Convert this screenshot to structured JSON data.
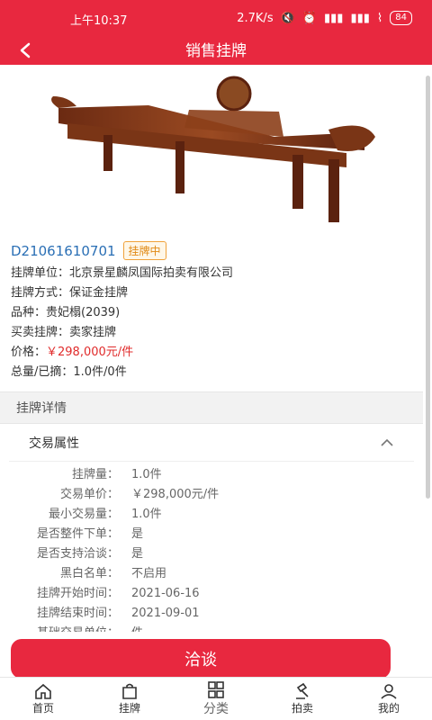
{
  "status": {
    "time": "上午10:37",
    "net_speed": "2.7K/s",
    "battery": "84"
  },
  "navbar": {
    "title": "销售挂牌"
  },
  "listing": {
    "code": "D21061610701",
    "status_tag": "挂牌中",
    "unit": "挂牌单位：北京景星麟凤国际拍卖有限公司",
    "method": "挂牌方式：保证金挂牌",
    "variety": "品种：贵妃榻(2039)",
    "trade": "买卖挂牌：卖家挂牌",
    "price_label": "价格：",
    "price_value": "￥298,000元/件",
    "total": "总量/已摘：1.0件/0件"
  },
  "detail": {
    "section_title": "挂牌详情",
    "accordion_title": "交易属性",
    "props": [
      {
        "k": "挂牌量：",
        "v": "1.0件"
      },
      {
        "k": "交易单价：",
        "v": "￥298,000元/件"
      },
      {
        "k": "最小交易量：",
        "v": "1.0件"
      },
      {
        "k": "是否整件下单：",
        "v": "是"
      },
      {
        "k": "是否支持洽谈：",
        "v": "是"
      },
      {
        "k": "黑白名单：",
        "v": "不启用"
      },
      {
        "k": "挂牌开始时间：",
        "v": "2021-06-16"
      },
      {
        "k": "挂牌结束时间：",
        "v": "2021-09-01"
      },
      {
        "k": "基础交易单位：",
        "v": "件"
      }
    ]
  },
  "cta": {
    "label": "洽谈"
  },
  "tabbar": {
    "items": [
      {
        "label": "首页",
        "icon": "home-icon"
      },
      {
        "label": "挂牌",
        "icon": "bag-icon"
      },
      {
        "label": "分类",
        "icon": "grid-icon"
      },
      {
        "label": "拍卖",
        "icon": "gavel-icon"
      },
      {
        "label": "我的",
        "icon": "user-icon"
      }
    ]
  },
  "colors": {
    "brand": "#e8283f",
    "price": "#e02b2b",
    "code": "#2a6fb5",
    "tag": "#e08a16"
  }
}
